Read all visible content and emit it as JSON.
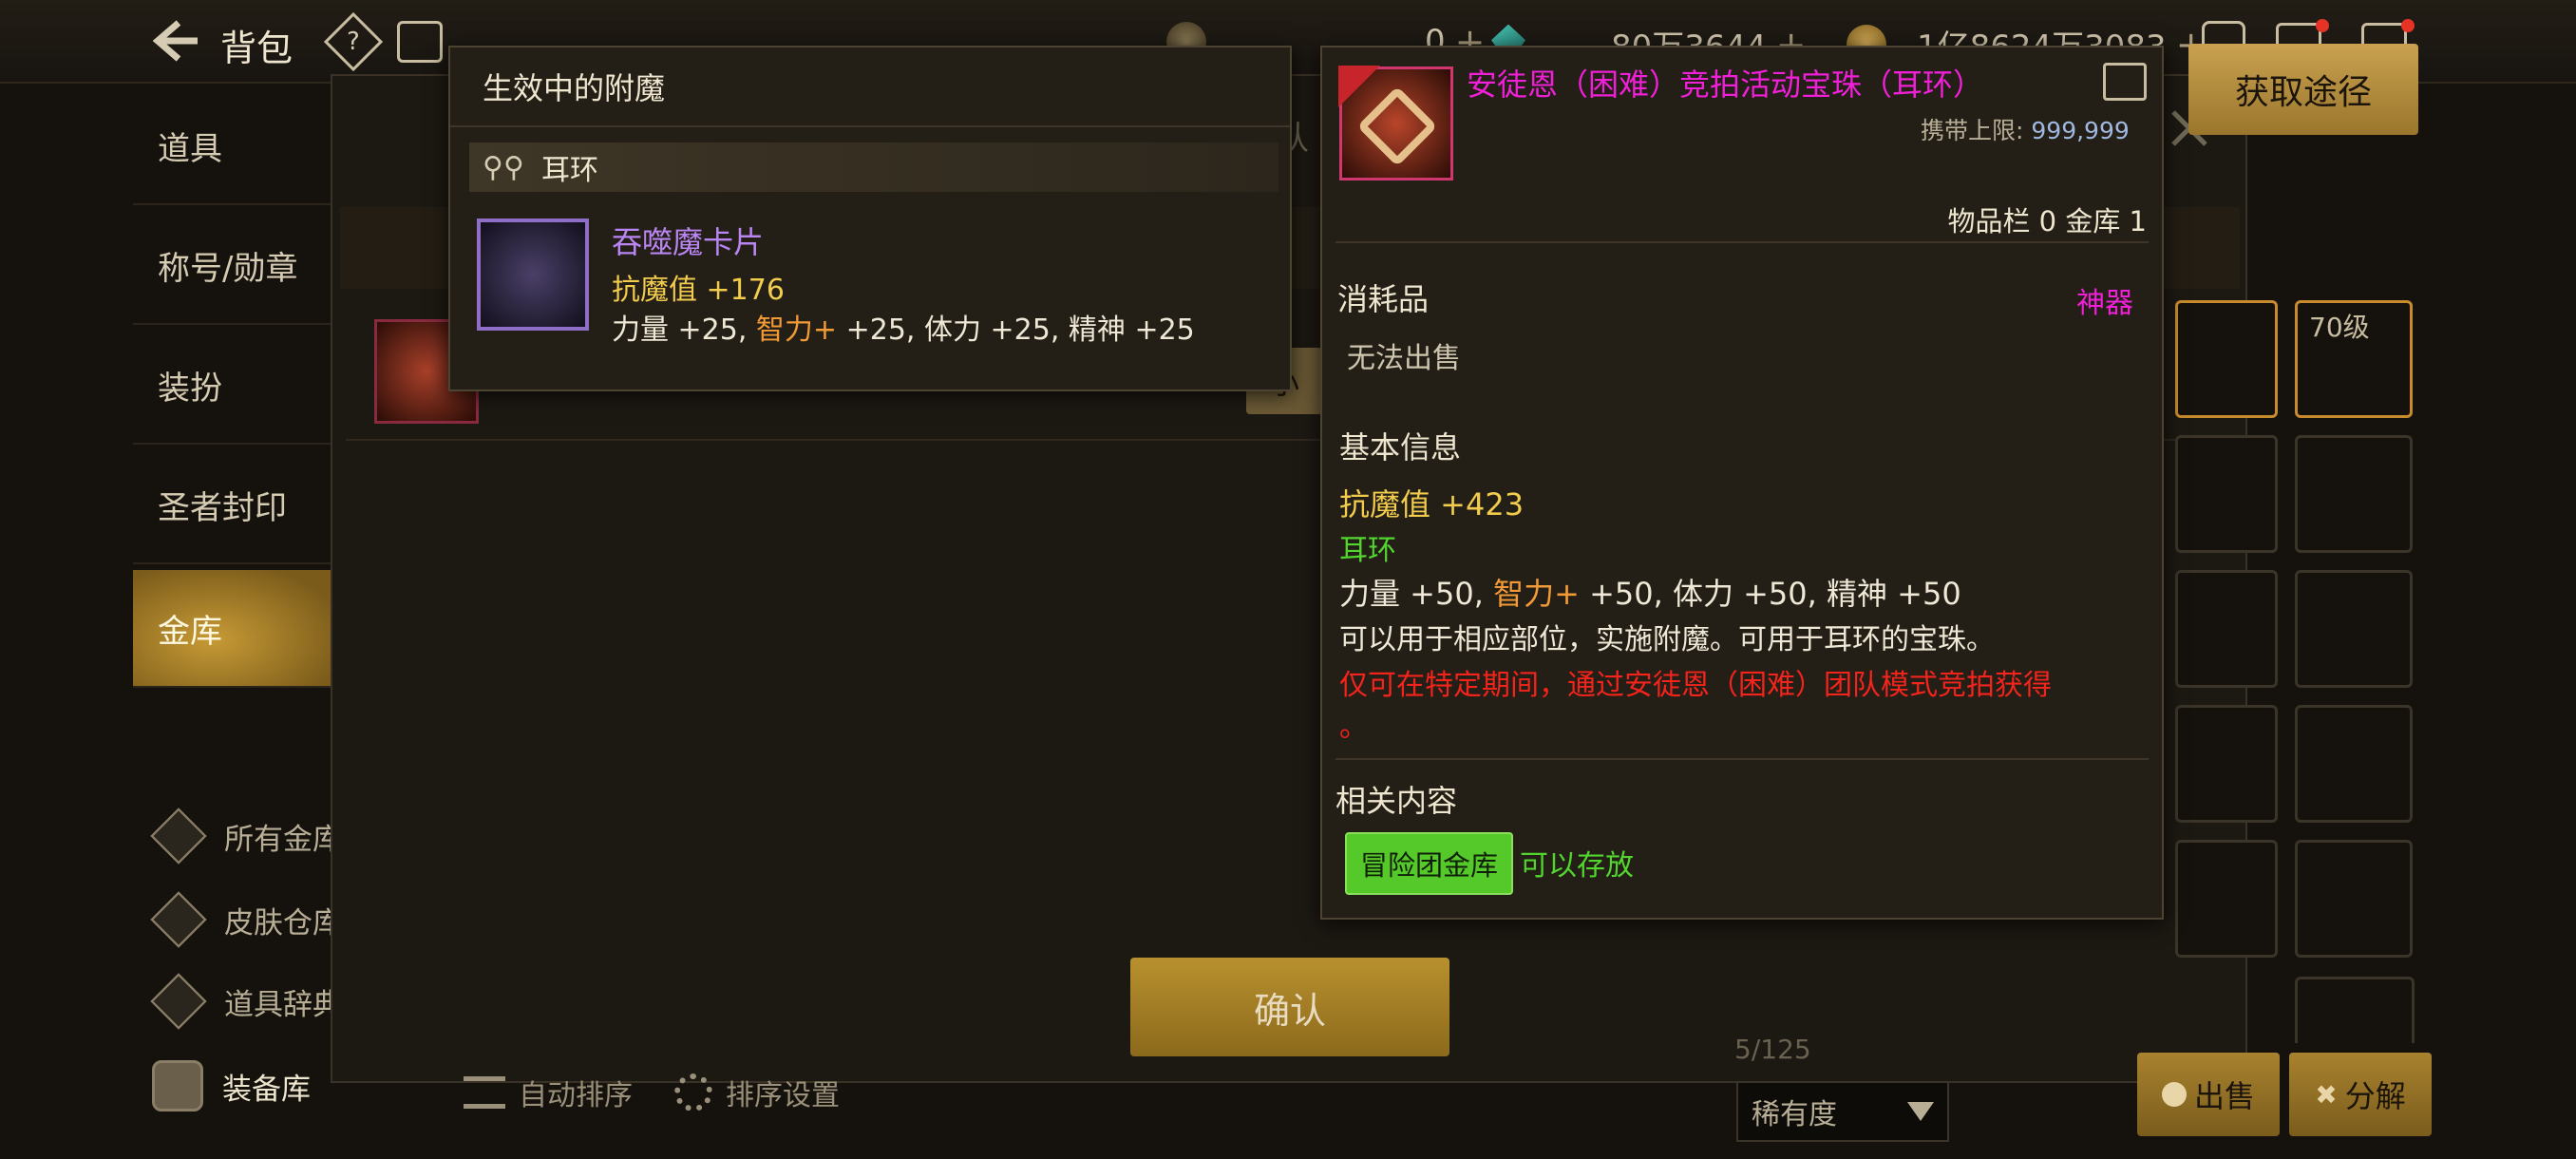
{
  "topbar": {
    "title": "背包",
    "currency_1": "0",
    "currency_2": "80万3644",
    "currency_3": "1亿8624万3083"
  },
  "sidebar": {
    "tabs": [
      {
        "label": "道具"
      },
      {
        "label": "称号/勋章"
      },
      {
        "label": "装扮"
      },
      {
        "label": "圣者封印"
      },
      {
        "label": "金库"
      }
    ],
    "subnav": [
      {
        "label": "所有金库"
      },
      {
        "label": "皮肤仓库"
      },
      {
        "label": "道具辞典"
      },
      {
        "label": "装备库"
      }
    ]
  },
  "enchant_panel": {
    "title": "生效中的附魔",
    "slot_label": "耳环",
    "card_name": "吞噬魔卡片",
    "magic_resist": "抗魔值 +176",
    "stat_str": "力量 +25, ",
    "stat_int_label": "智力",
    "stat_int_value": " +25",
    "stat_rest": ", 体力 +25, 精神 +25"
  },
  "item_detail": {
    "name": "安徒恩（困难）竞拍活动宝珠（耳环）",
    "carry_limit_label": "携带上限:",
    "carry_limit_value": "999,999",
    "inventory_count": "物品栏 0 金库 1",
    "category": "消耗品",
    "rarity": "神器",
    "cannot_sell": "无法出售",
    "basic_info_title": "基本信息",
    "magic_resist": "抗魔值 +423",
    "slot": "耳环",
    "stat_str": "力量 +50, ",
    "stat_int_label": "智力",
    "stat_int_value": " +50",
    "stat_rest": ", 体力 +50, 精神 +50",
    "description": "可以用于相应部位，实施附魔。可用于耳环的宝珠。",
    "obtain_note": "仅可在特定期间，通过安徒恩（困难）团队模式竞拍获得",
    "obtain_note_end": "。",
    "related_title": "相关内容",
    "related_tag": "冒险团金库",
    "related_status": "可以存放"
  },
  "buttons": {
    "get_route": "获取途径",
    "confirm": "确认",
    "auto_sort": "自动排序",
    "sort_settings": "排序设置",
    "sell": "出售",
    "disassemble": "分解",
    "rarity_filter": "稀有度",
    "small": "小"
  },
  "background": {
    "count": "5/125",
    "level_badge": "70级",
    "confirm_ghost": "确认"
  },
  "colors": {
    "gold_accent": "#c9a150",
    "magenta": "#f020d8",
    "green": "#52d52e",
    "red": "#f2241c",
    "purple": "#b985f2"
  }
}
